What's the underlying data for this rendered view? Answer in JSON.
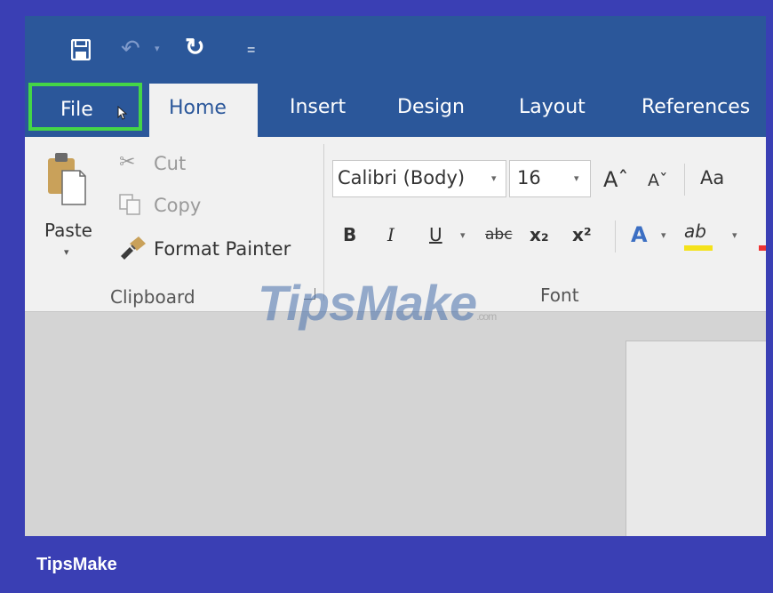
{
  "quick_access": {
    "save_icon": "save-icon",
    "undo_glyph": "↶",
    "dropdown_glyph": "▾",
    "redo_glyph": "↻",
    "customize_glyph": "="
  },
  "tabs": [
    {
      "label": "File",
      "selected": false,
      "highlighted": true
    },
    {
      "label": "Home",
      "selected": true
    },
    {
      "label": "Insert"
    },
    {
      "label": "Design"
    },
    {
      "label": "Layout"
    },
    {
      "label": "References"
    }
  ],
  "clipboard": {
    "paste_label": "Paste",
    "cut_glyph": "✂",
    "cut_label": "Cut",
    "copy_label": "Copy",
    "painter_label": "Format Painter",
    "group_label": "Clipboard"
  },
  "font": {
    "font_name": "Calibri (Body)",
    "font_size": "16",
    "grow_glyph": "Aˆ",
    "shrink_glyph": "Aˇ",
    "change_case": "Aa",
    "bold": "B",
    "italic": "I",
    "underline": "U",
    "strike": "abc",
    "subscript": "x₂",
    "superscript": "x²",
    "text_effects": "A",
    "highlight": "ab",
    "group_label": "Font"
  },
  "colors": {
    "title_bar": "#2b579a",
    "highlight_frame": "#44d647",
    "page_border": "#3a3fb4"
  },
  "watermark": {
    "text": "TipsMake",
    "suffix": ".com"
  },
  "footer": {
    "brand": "TipsMake"
  }
}
